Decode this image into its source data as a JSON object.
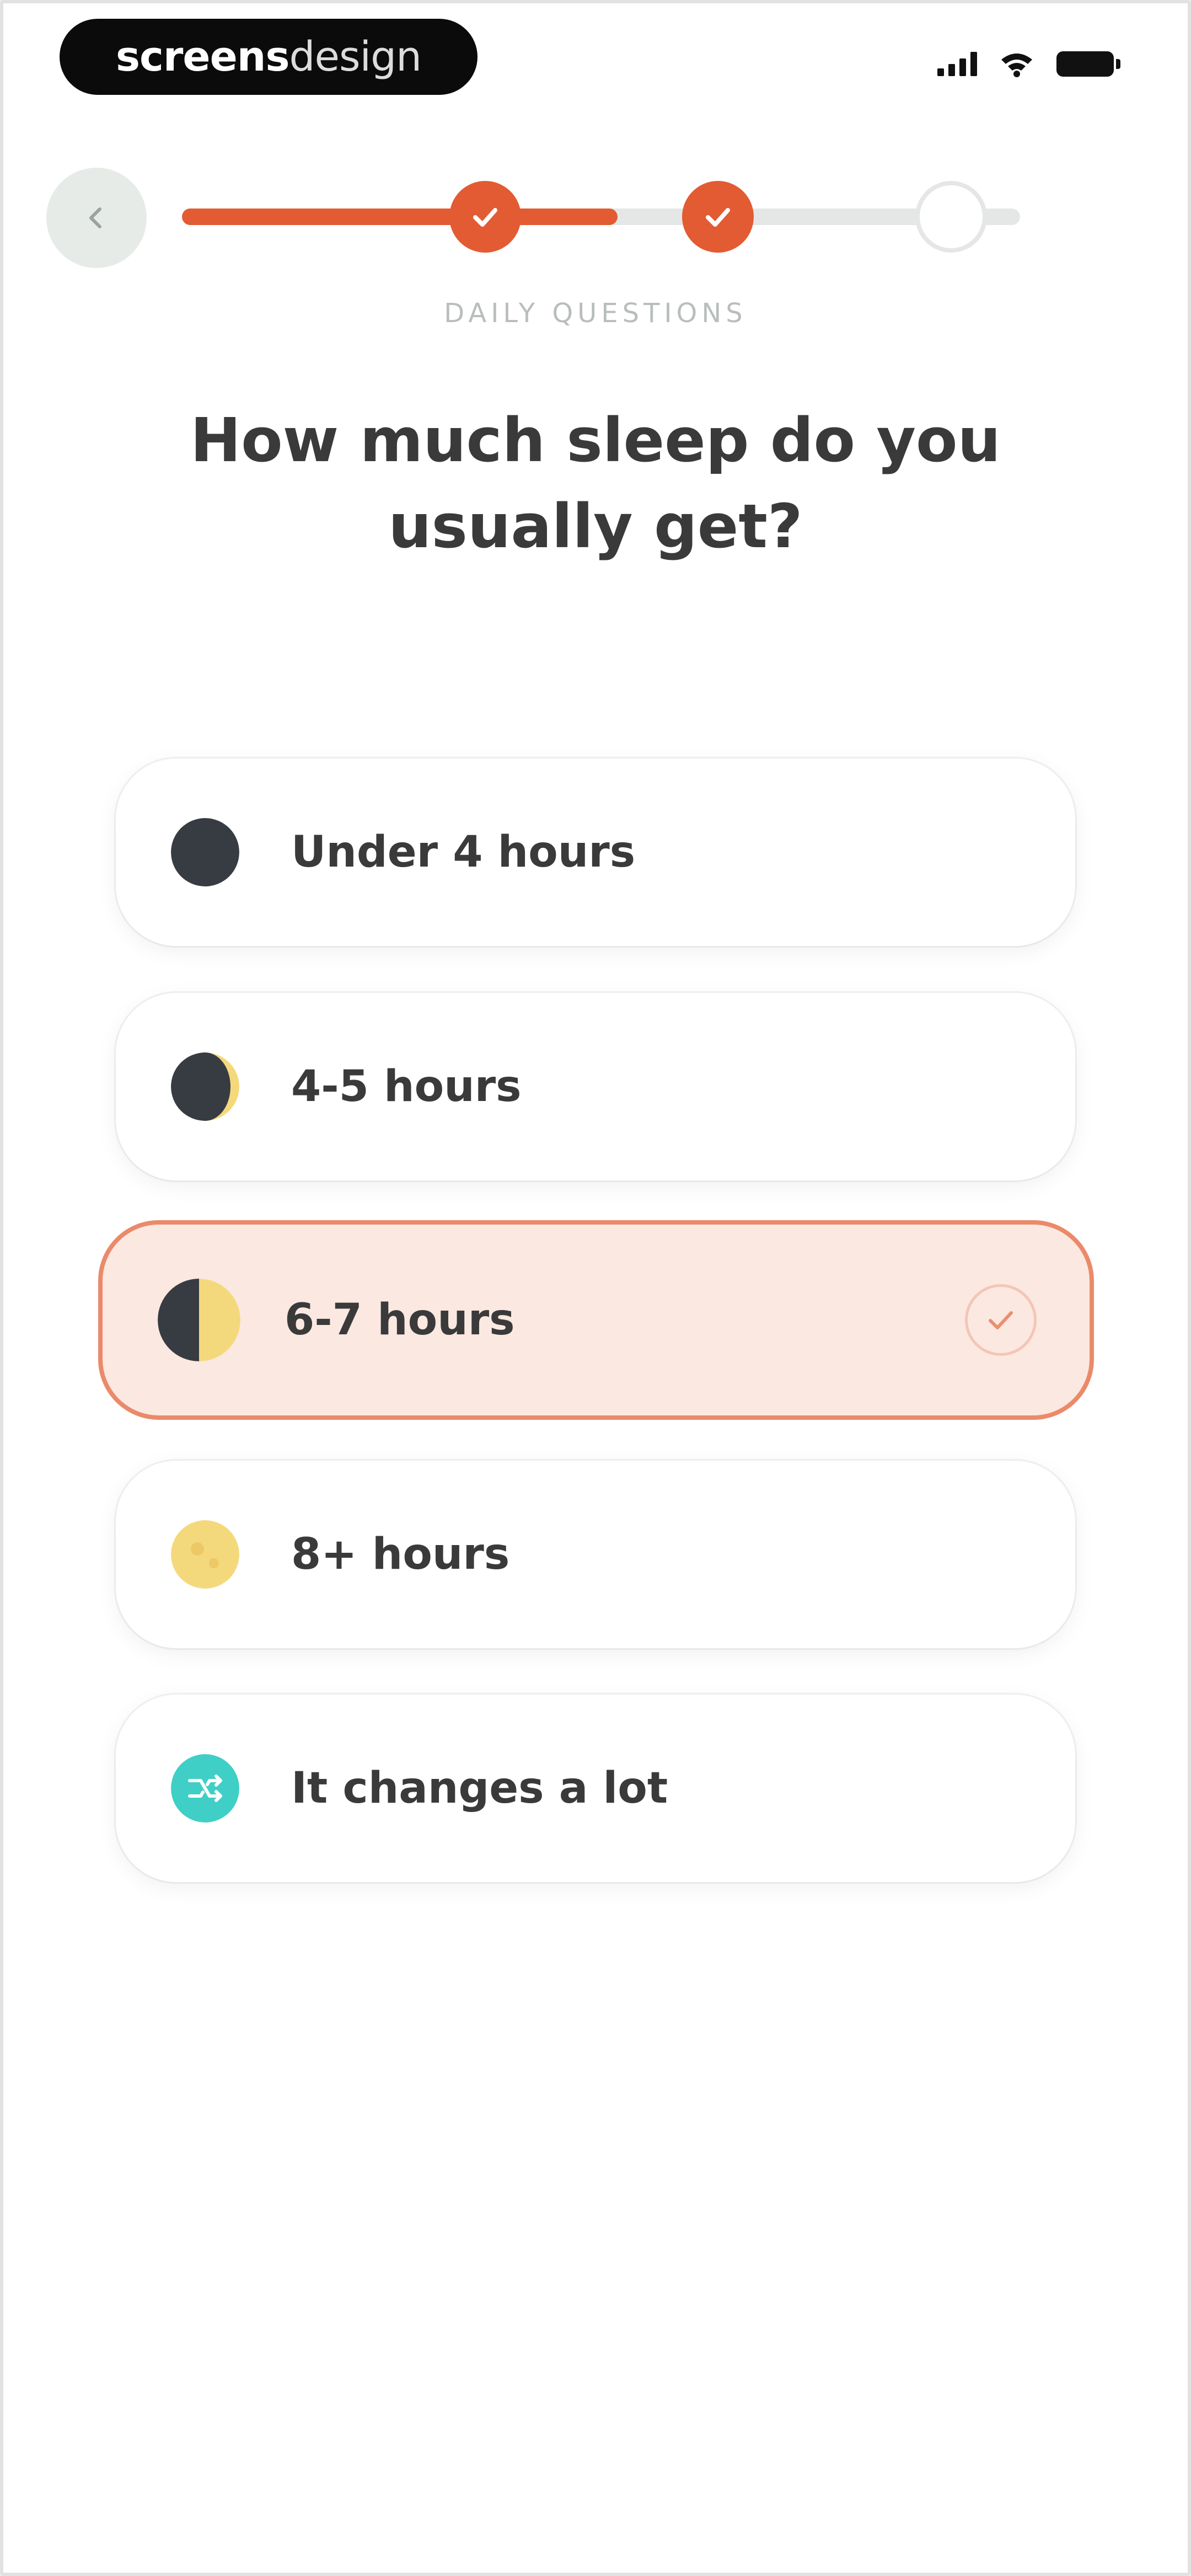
{
  "status_bar": {
    "brand_bold": "screens",
    "brand_light": "design"
  },
  "header": {
    "back_icon": "chevron-left-icon",
    "progress": {
      "steps_total": 3,
      "steps_completed": 2,
      "fill_fraction": 0.52
    },
    "section_label": "DAILY QUESTIONS"
  },
  "question": {
    "title": "How much sleep do you usually get?"
  },
  "options": [
    {
      "label": "Under 4 hours",
      "icon": "new-moon-icon",
      "selected": false
    },
    {
      "label": "4-5 hours",
      "icon": "crescent-moon-icon",
      "selected": false
    },
    {
      "label": "6-7 hours",
      "icon": "half-moon-icon",
      "selected": true
    },
    {
      "label": "8+ hours",
      "icon": "full-moon-icon",
      "selected": false
    },
    {
      "label": "It changes a lot",
      "icon": "shuffle-icon",
      "selected": false
    }
  ],
  "colors": {
    "accent": "#e35b32",
    "selected_bg": "#fbe8e1",
    "selected_border": "#ea8a6a",
    "moon_dark": "#373c42",
    "moon_light": "#f4d97c",
    "teal": "#3fcfc6"
  }
}
